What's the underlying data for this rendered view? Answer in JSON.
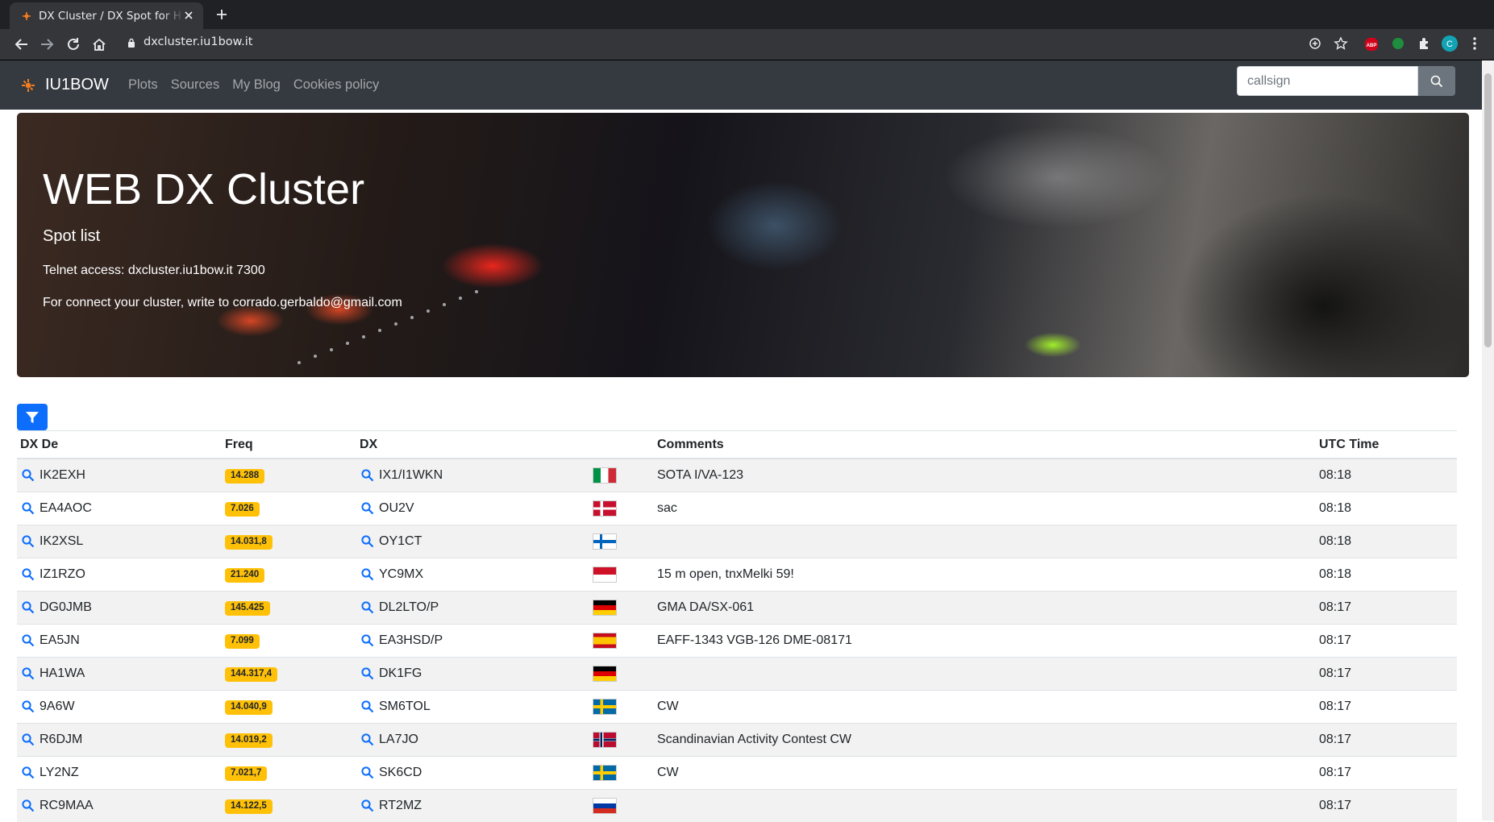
{
  "browser": {
    "tab_title": "DX Cluster / DX Spot for H",
    "url": "dxcluster.iu1bow.it"
  },
  "navbar": {
    "brand": "IU1BOW",
    "links": [
      "Plots",
      "Sources",
      "My Blog",
      "Cookies policy"
    ],
    "search_placeholder": "callsign"
  },
  "hero": {
    "title": "WEB DX Cluster",
    "subtitle": "Spot list",
    "telnet": "Telnet access: dxcluster.iu1bow.it 7300",
    "contact": "For connect your cluster, write to corrado.gerbaldo@gmail.com"
  },
  "table": {
    "headers": [
      "DX De",
      "Freq",
      "DX",
      "",
      "Comments",
      "UTC Time"
    ],
    "rows": [
      {
        "de": "IK2EXH",
        "freq": "14.288",
        "dx": "IX1/I1WKN",
        "flag": "italy",
        "comment": "SOTA I/VA-123",
        "time": "08:18"
      },
      {
        "de": "EA4AOC",
        "freq": "7.026",
        "dx": "OU2V",
        "flag": "denmark",
        "comment": "sac",
        "time": "08:18"
      },
      {
        "de": "IK2XSL",
        "freq": "14.031,8",
        "dx": "OY1CT",
        "flag": "faroe",
        "comment": "",
        "time": "08:18"
      },
      {
        "de": "IZ1RZO",
        "freq": "21.240",
        "dx": "YC9MX",
        "flag": "indonesia",
        "comment": "15 m open, tnxMelki 59!",
        "time": "08:18"
      },
      {
        "de": "DG0JMB",
        "freq": "145.425",
        "dx": "DL2LTO/P",
        "flag": "germany",
        "comment": "GMA DA/SX-061",
        "time": "08:17"
      },
      {
        "de": "EA5JN",
        "freq": "7.099",
        "dx": "EA3HSD/P",
        "flag": "spain",
        "comment": "EAFF-1343 VGB-126 DME-08171",
        "time": "08:17"
      },
      {
        "de": "HA1WA",
        "freq": "144.317,4",
        "dx": "DK1FG",
        "flag": "germany",
        "comment": "",
        "time": "08:17"
      },
      {
        "de": "9A6W",
        "freq": "14.040,9",
        "dx": "SM6TOL",
        "flag": "sweden",
        "comment": "CW",
        "time": "08:17"
      },
      {
        "de": "R6DJM",
        "freq": "14.019,2",
        "dx": "LA7JO",
        "flag": "norway",
        "comment": "Scandinavian Activity Contest CW",
        "time": "08:17"
      },
      {
        "de": "LY2NZ",
        "freq": "7.021,7",
        "dx": "SK6CD",
        "flag": "sweden",
        "comment": "CW",
        "time": "08:17"
      },
      {
        "de": "RC9MAA",
        "freq": "14.122,5",
        "dx": "RT2MZ",
        "flag": "russia",
        "comment": "",
        "time": "08:17"
      }
    ]
  },
  "colors": {
    "navbar_bg": "#343a40",
    "badge": "#ffc107",
    "primary": "#0d6efd",
    "link_blue": "#0d6efd"
  }
}
